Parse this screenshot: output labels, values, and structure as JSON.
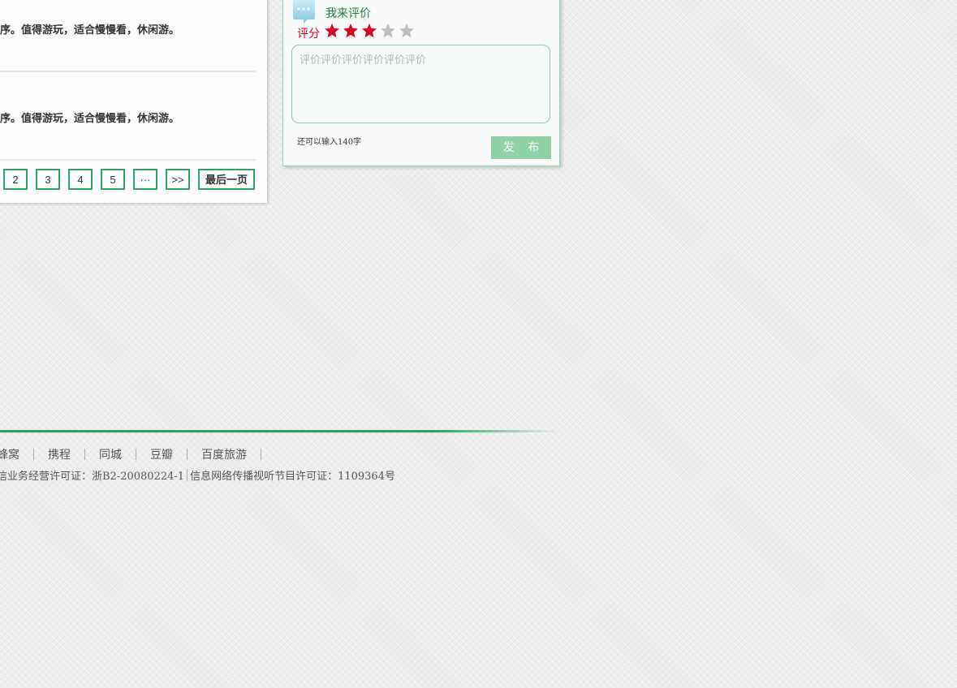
{
  "reviews": [
    {
      "text": "序。值得游玩，适合慢慢看，休闲游。"
    },
    {
      "text": "序。值得游玩，适合慢慢看，休闲游。"
    }
  ],
  "pagination": {
    "pages": [
      "2",
      "3",
      "4",
      "5"
    ],
    "ellipsis": "···",
    "next": ">>",
    "last": "最后一页"
  },
  "review_form": {
    "title": "我来评价",
    "rating_label": "评分",
    "rating_value": 3,
    "rating_max": 5,
    "placeholder": "评价评价评价评价评价评价",
    "char_count_text": "还可以输入140字",
    "submit_label": "发 布",
    "colors": {
      "star_active": "#e0001b",
      "star_inactive": "#bdbdbd",
      "accent": "#2aa563"
    }
  },
  "footer": {
    "links": [
      "蜂窝",
      "携程",
      "同城",
      "豆瓣",
      "百度旅游"
    ],
    "license_part1": "信业务经营许可证：浙B2-20080224-1",
    "license_part2": "信息网络传播视听节目许可证：1109364号"
  }
}
